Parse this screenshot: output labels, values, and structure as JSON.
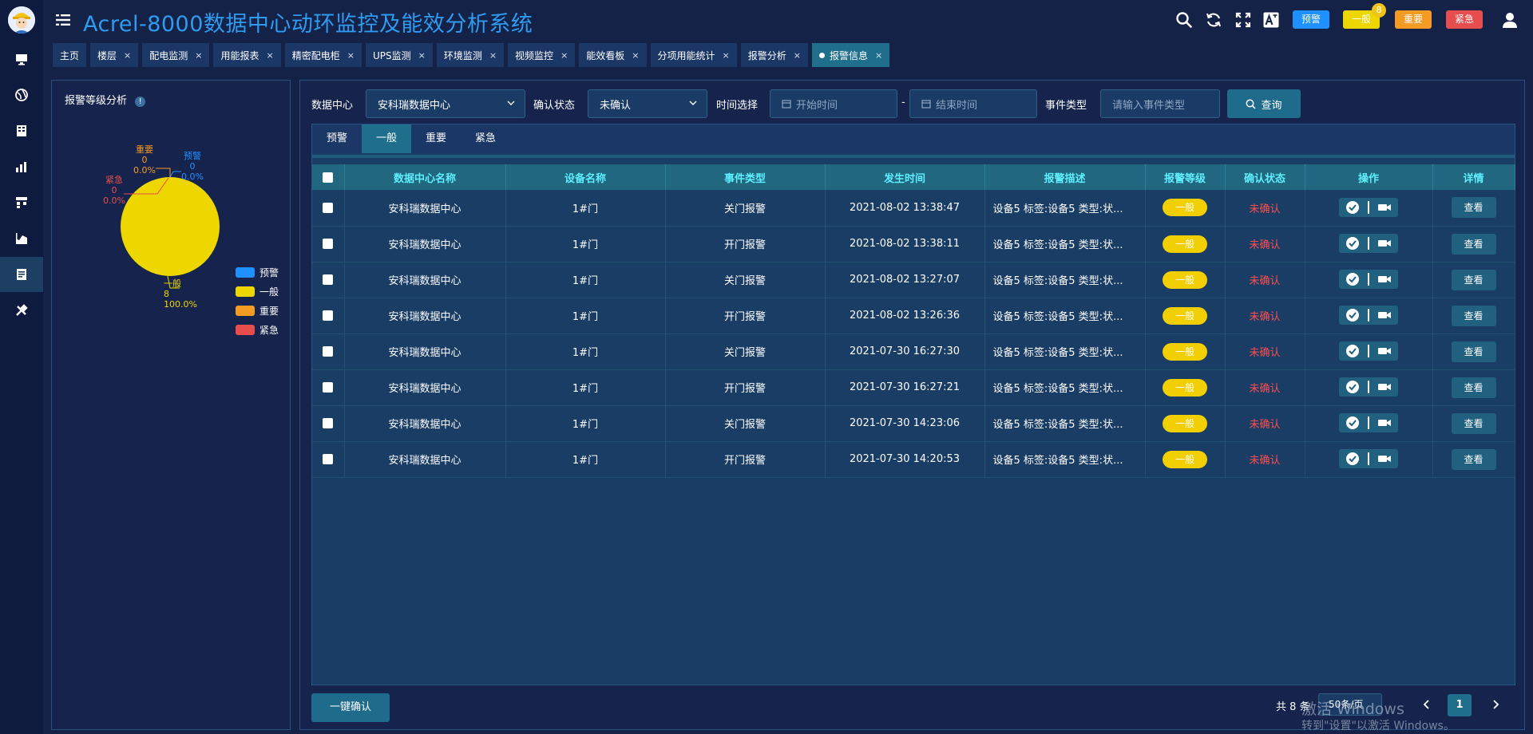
{
  "header": {
    "title": "Acrel-8000数据中心动环监控及能效分析系统",
    "level_buttons": {
      "warning": "预警",
      "general": "一般",
      "important": "重要",
      "urgent": "紧急"
    },
    "general_badge": "8",
    "icons": [
      "search-icon",
      "refresh-icon",
      "fullscreen-icon",
      "translate-icon",
      "user-icon"
    ]
  },
  "sidebar": {
    "items": [
      "monitor-icon",
      "globe-icon",
      "building-icon",
      "bar-chart-icon",
      "flow-icon",
      "area-chart-icon",
      "report-icon",
      "tools-icon"
    ],
    "active_index": 6
  },
  "tabs": [
    {
      "label": "主页",
      "closable": false
    },
    {
      "label": "楼层",
      "closable": true
    },
    {
      "label": "配电监测",
      "closable": true
    },
    {
      "label": "用能报表",
      "closable": true
    },
    {
      "label": "精密配电柜",
      "closable": true
    },
    {
      "label": "UPS监测",
      "closable": true
    },
    {
      "label": "环境监测",
      "closable": true
    },
    {
      "label": "视频监控",
      "closable": true
    },
    {
      "label": "能效看板",
      "closable": true
    },
    {
      "label": "分项用能统计",
      "closable": true
    },
    {
      "label": "报警分析",
      "closable": true
    },
    {
      "label": "报警信息",
      "closable": true,
      "active": true
    }
  ],
  "tab_close_glyph": "×",
  "left_panel": {
    "title": "报警等级分析",
    "info_glyph": "!",
    "legend": [
      "预警",
      "一般",
      "重要",
      "紧急"
    ]
  },
  "chart_data": {
    "type": "pie",
    "categories": [
      "预警",
      "一般",
      "重要",
      "紧急"
    ],
    "values": [
      0,
      8,
      0,
      0
    ],
    "percent_labels": [
      "0.0%",
      "100.0%",
      "0.0%",
      "0.0%"
    ],
    "colors": [
      "#1e90ff",
      "#eed600",
      "#f59a23",
      "#e84d4d"
    ],
    "legend_position": "right"
  },
  "filters": {
    "data_center_label": "数据中心",
    "data_center_value": "安科瑞数据中心",
    "confirm_label": "确认状态",
    "confirm_value": "未确认",
    "time_label": "时间选择",
    "start_placeholder": "开始时间",
    "range_sep": "-",
    "end_placeholder": "结束时间",
    "event_label": "事件类型",
    "event_placeholder": "请输入事件类型",
    "query_label": "查询"
  },
  "level_tabs": [
    {
      "label": "预警"
    },
    {
      "label": "一般",
      "active": true
    },
    {
      "label": "重要"
    },
    {
      "label": "紧急"
    }
  ],
  "table": {
    "columns": [
      "数据中心名称",
      "设备名称",
      "事件类型",
      "发生时间",
      "报警描述",
      "报警等级",
      "确认状态",
      "操作",
      "详情"
    ],
    "rows": [
      {
        "center": "安科瑞数据中心",
        "device": "1#门",
        "event": "关门报警",
        "time": "2021-08-02 13:38:47",
        "desc": "设备5 标签:设备5 类型:状...",
        "level": "一般",
        "status": "未确认",
        "detail": "查看"
      },
      {
        "center": "安科瑞数据中心",
        "device": "1#门",
        "event": "开门报警",
        "time": "2021-08-02 13:38:11",
        "desc": "设备5 标签:设备5 类型:状...",
        "level": "一般",
        "status": "未确认",
        "detail": "查看"
      },
      {
        "center": "安科瑞数据中心",
        "device": "1#门",
        "event": "关门报警",
        "time": "2021-08-02 13:27:07",
        "desc": "设备5 标签:设备5 类型:状...",
        "level": "一般",
        "status": "未确认",
        "detail": "查看"
      },
      {
        "center": "安科瑞数据中心",
        "device": "1#门",
        "event": "开门报警",
        "time": "2021-08-02 13:26:36",
        "desc": "设备5 标签:设备5 类型:状...",
        "level": "一般",
        "status": "未确认",
        "detail": "查看"
      },
      {
        "center": "安科瑞数据中心",
        "device": "1#门",
        "event": "关门报警",
        "time": "2021-07-30 16:27:30",
        "desc": "设备5 标签:设备5 类型:状...",
        "level": "一般",
        "status": "未确认",
        "detail": "查看"
      },
      {
        "center": "安科瑞数据中心",
        "device": "1#门",
        "event": "开门报警",
        "time": "2021-07-30 16:27:21",
        "desc": "设备5 标签:设备5 类型:状...",
        "level": "一般",
        "status": "未确认",
        "detail": "查看"
      },
      {
        "center": "安科瑞数据中心",
        "device": "1#门",
        "event": "关门报警",
        "time": "2021-07-30 14:23:06",
        "desc": "设备5 标签:设备5 类型:状...",
        "level": "一般",
        "status": "未确认",
        "detail": "查看"
      },
      {
        "center": "安科瑞数据中心",
        "device": "1#门",
        "event": "开门报警",
        "time": "2021-07-30 14:20:53",
        "desc": "设备5 标签:设备5 类型:状...",
        "level": "一般",
        "status": "未确认",
        "detail": "查看"
      }
    ]
  },
  "footer": {
    "confirm_all_label": "一键确认",
    "total_text": "共 8 条",
    "page_size_text": "50条/页",
    "current_page": "1"
  },
  "watermark": {
    "line1": "激活 Windows",
    "line2": "转到\"设置\"以激活 Windows。"
  },
  "colors": {
    "background": "#152248",
    "title": "#2f9bf0",
    "header_cell_text": "#5ef0ff",
    "warning": "#1e90ff",
    "general": "#f2cf00",
    "important": "#f59a23",
    "urgent": "#e84d4d",
    "unconfirmed": "#ff4d4d"
  }
}
